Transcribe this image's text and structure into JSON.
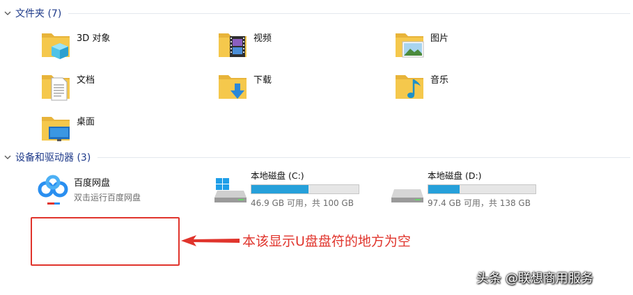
{
  "folders_section": {
    "title": "文件夹 (7)"
  },
  "folders": [
    {
      "label": "3D 对象",
      "icon": "3d-objects-folder-icon"
    },
    {
      "label": "视频",
      "icon": "videos-folder-icon"
    },
    {
      "label": "图片",
      "icon": "pictures-folder-icon"
    },
    {
      "label": "文档",
      "icon": "documents-folder-icon"
    },
    {
      "label": "下载",
      "icon": "downloads-folder-icon"
    },
    {
      "label": "音乐",
      "icon": "music-folder-icon"
    },
    {
      "label": "桌面",
      "icon": "desktop-folder-icon"
    }
  ],
  "devices_section": {
    "title": "设备和驱动器 (3)"
  },
  "baidu": {
    "name": "百度网盘",
    "subtitle": "双击运行百度网盘",
    "icon": "baidu-netdisk-icon"
  },
  "drives": [
    {
      "name": "本地磁盘 (C:)",
      "capacity": "46.9 GB 可用，共 100 GB",
      "used_fraction": 0.531,
      "icon": "windows-drive-icon"
    },
    {
      "name": "本地磁盘 (D:)",
      "capacity": "97.4 GB 可用，共 138 GB",
      "used_fraction": 0.294,
      "icon": "hard-drive-icon"
    }
  ],
  "annotation": {
    "text": "本该显示U盘盘符的地方为空",
    "color": "#e0342c"
  },
  "watermark": {
    "text": "头条 @联想商用服务"
  },
  "colors": {
    "folder": "#f5c84c",
    "accent": "#26a0da",
    "section_header": "#1e3a8a",
    "annotation": "#e0342c"
  }
}
